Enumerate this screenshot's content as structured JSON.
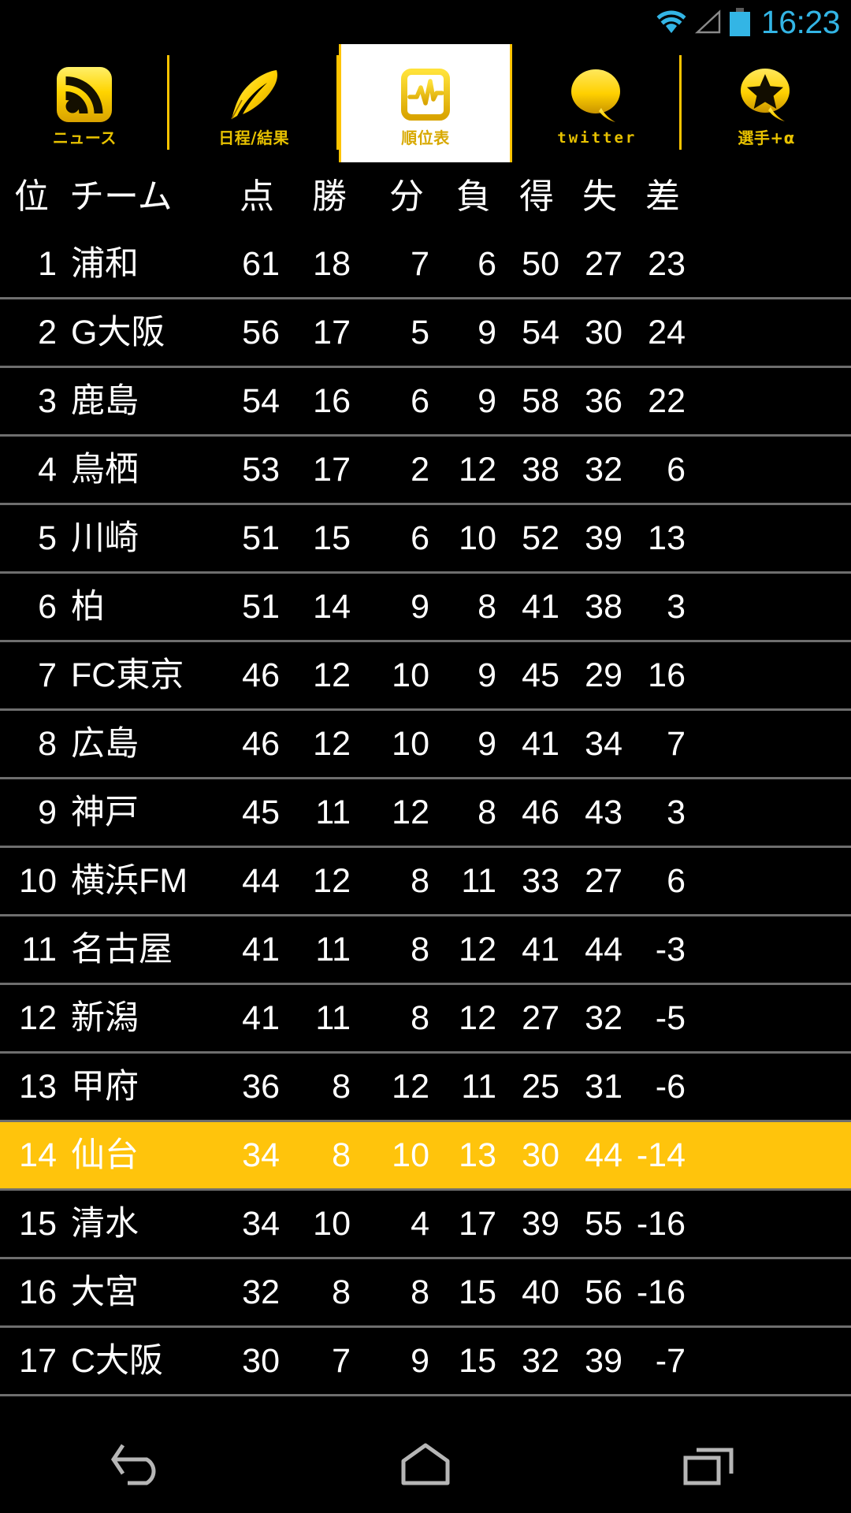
{
  "status_bar": {
    "time": "16:23",
    "icons": [
      "wifi-icon",
      "cell-signal-icon",
      "battery-icon"
    ],
    "accent_color": "#33B5E5"
  },
  "tabs": {
    "accent_color": "#FFC400",
    "active_index": 2,
    "items": [
      {
        "label": "ニュース",
        "icon": "rss-icon",
        "active": false
      },
      {
        "label": "日程/結果",
        "icon": "quill-feather-icon",
        "active": false
      },
      {
        "label": "順位表",
        "icon": "chart-monitor-icon",
        "active": true
      },
      {
        "label": "twitter",
        "icon": "speech-bubble-icon",
        "active": false
      },
      {
        "label": "選手+α",
        "icon": "star-bubble-icon",
        "active": false
      }
    ]
  },
  "standings": {
    "highlight_row_rank": "14",
    "highlight_color": "#FFC40C",
    "separator_color": "#6E6E6E",
    "columns": [
      {
        "key": "rank",
        "label": "位"
      },
      {
        "key": "team",
        "label": "チーム"
      },
      {
        "key": "pt",
        "label": "点"
      },
      {
        "key": "w",
        "label": "勝"
      },
      {
        "key": "d",
        "label": "分"
      },
      {
        "key": "l",
        "label": "負"
      },
      {
        "key": "gf",
        "label": "得"
      },
      {
        "key": "ga",
        "label": "失"
      },
      {
        "key": "gd",
        "label": "差"
      }
    ],
    "rows": [
      {
        "rank": "1",
        "team": "浦和",
        "pt": "61",
        "w": "18",
        "d": "7",
        "l": "6",
        "gf": "50",
        "ga": "27",
        "gd": "23",
        "highlight": false
      },
      {
        "rank": "2",
        "team": "G大阪",
        "pt": "56",
        "w": "17",
        "d": "5",
        "l": "9",
        "gf": "54",
        "ga": "30",
        "gd": "24",
        "highlight": false
      },
      {
        "rank": "3",
        "team": "鹿島",
        "pt": "54",
        "w": "16",
        "d": "6",
        "l": "9",
        "gf": "58",
        "ga": "36",
        "gd": "22",
        "highlight": false
      },
      {
        "rank": "4",
        "team": "鳥栖",
        "pt": "53",
        "w": "17",
        "d": "2",
        "l": "12",
        "gf": "38",
        "ga": "32",
        "gd": "6",
        "highlight": false
      },
      {
        "rank": "5",
        "team": "川崎",
        "pt": "51",
        "w": "15",
        "d": "6",
        "l": "10",
        "gf": "52",
        "ga": "39",
        "gd": "13",
        "highlight": false
      },
      {
        "rank": "6",
        "team": "柏",
        "pt": "51",
        "w": "14",
        "d": "9",
        "l": "8",
        "gf": "41",
        "ga": "38",
        "gd": "3",
        "highlight": false
      },
      {
        "rank": "7",
        "team": "FC東京",
        "pt": "46",
        "w": "12",
        "d": "10",
        "l": "9",
        "gf": "45",
        "ga": "29",
        "gd": "16",
        "highlight": false
      },
      {
        "rank": "8",
        "team": "広島",
        "pt": "46",
        "w": "12",
        "d": "10",
        "l": "9",
        "gf": "41",
        "ga": "34",
        "gd": "7",
        "highlight": false
      },
      {
        "rank": "9",
        "team": "神戸",
        "pt": "45",
        "w": "11",
        "d": "12",
        "l": "8",
        "gf": "46",
        "ga": "43",
        "gd": "3",
        "highlight": false
      },
      {
        "rank": "10",
        "team": "横浜FM",
        "pt": "44",
        "w": "12",
        "d": "8",
        "l": "11",
        "gf": "33",
        "ga": "27",
        "gd": "6",
        "highlight": false
      },
      {
        "rank": "11",
        "team": "名古屋",
        "pt": "41",
        "w": "11",
        "d": "8",
        "l": "12",
        "gf": "41",
        "ga": "44",
        "gd": "-3",
        "highlight": false
      },
      {
        "rank": "12",
        "team": "新潟",
        "pt": "41",
        "w": "11",
        "d": "8",
        "l": "12",
        "gf": "27",
        "ga": "32",
        "gd": "-5",
        "highlight": false
      },
      {
        "rank": "13",
        "team": "甲府",
        "pt": "36",
        "w": "8",
        "d": "12",
        "l": "11",
        "gf": "25",
        "ga": "31",
        "gd": "-6",
        "highlight": false
      },
      {
        "rank": "14",
        "team": "仙台",
        "pt": "34",
        "w": "8",
        "d": "10",
        "l": "13",
        "gf": "30",
        "ga": "44",
        "gd": "-14",
        "highlight": true
      },
      {
        "rank": "15",
        "team": "清水",
        "pt": "34",
        "w": "10",
        "d": "4",
        "l": "17",
        "gf": "39",
        "ga": "55",
        "gd": "-16",
        "highlight": false
      },
      {
        "rank": "16",
        "team": "大宮",
        "pt": "32",
        "w": "8",
        "d": "8",
        "l": "15",
        "gf": "40",
        "ga": "56",
        "gd": "-16",
        "highlight": false
      },
      {
        "rank": "17",
        "team": "C大阪",
        "pt": "30",
        "w": "7",
        "d": "9",
        "l": "15",
        "gf": "32",
        "ga": "39",
        "gd": "-7",
        "highlight": false
      }
    ]
  },
  "navigation_bar": {
    "buttons": [
      {
        "name": "back-icon"
      },
      {
        "name": "home-icon"
      },
      {
        "name": "recents-icon"
      }
    ]
  }
}
